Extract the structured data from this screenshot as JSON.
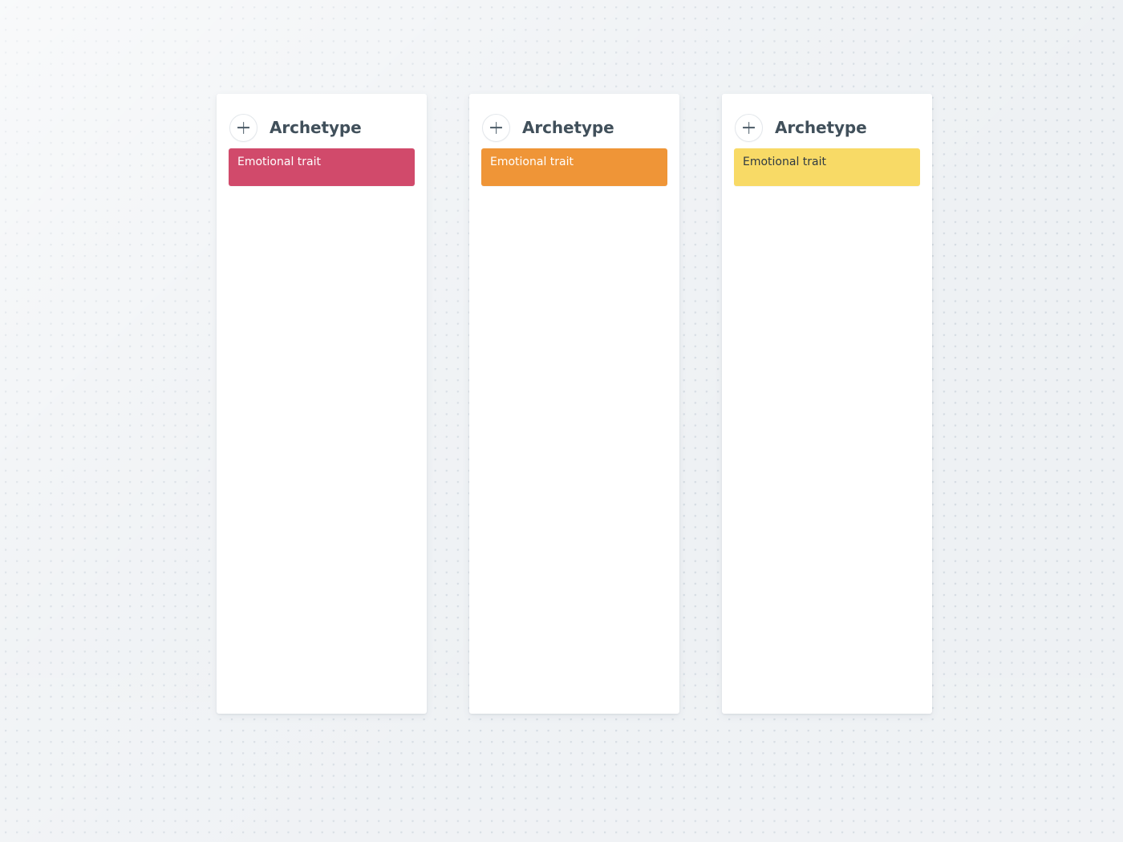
{
  "board": {
    "background_color": "#eef1f4",
    "dot_color": "#d4dbe2"
  },
  "columns": [
    {
      "add_label": "+",
      "title": "Archetype",
      "cards": [
        {
          "label": "Emotional trait",
          "color": "#d14a6b",
          "text_color": "#ffffff",
          "text_tone": "on-dark"
        }
      ]
    },
    {
      "add_label": "+",
      "title": "Archetype",
      "cards": [
        {
          "label": "Emotional trait",
          "color": "#ef9537",
          "text_color": "#ffffff",
          "text_tone": "on-dark"
        }
      ]
    },
    {
      "add_label": "+",
      "title": "Archetype",
      "cards": [
        {
          "label": "Emotional trait",
          "color": "#f8da66",
          "text_color": "#2f3a42",
          "text_tone": "on-light"
        }
      ]
    }
  ]
}
